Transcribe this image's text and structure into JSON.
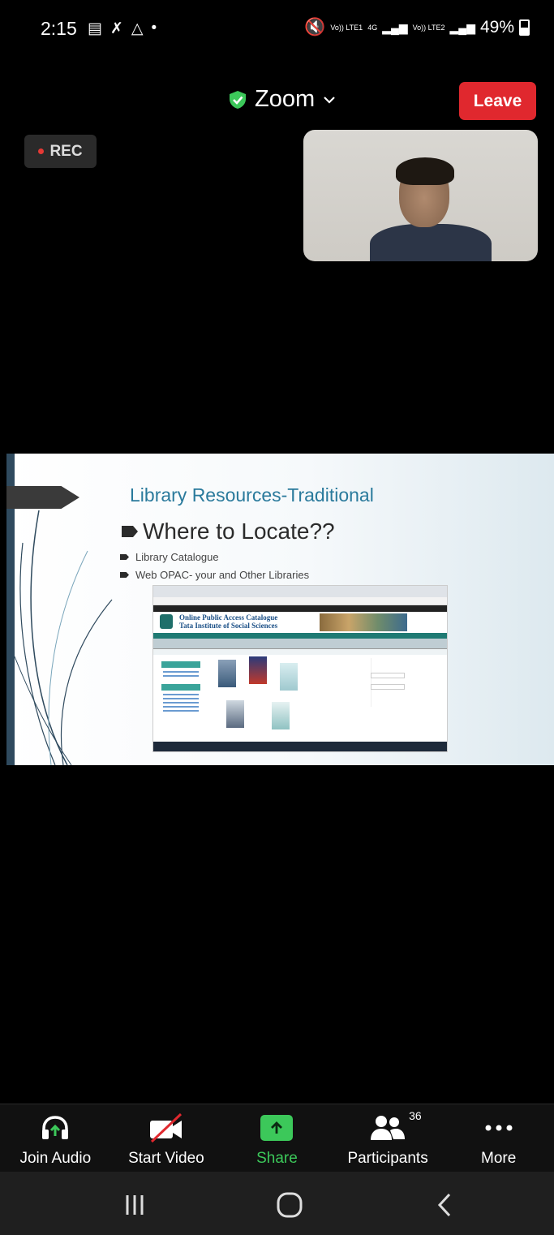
{
  "status_bar": {
    "time": "2:15",
    "network_1": "Vo)) LTE1",
    "network_mid": "4G",
    "network_2": "Vo)) LTE2",
    "battery": "49%"
  },
  "header": {
    "meeting_title": "Zoom",
    "leave_label": "Leave",
    "rec_label": "REC"
  },
  "slide": {
    "title": "Library Resources-Traditional",
    "subtitle": "Where to Locate??",
    "bullets": [
      "Library Catalogue",
      "Web OPAC- your and Other Libraries"
    ],
    "opac_title_1": "Online Public Access Catalogue",
    "opac_title_2": "Tata Institute of Social Sciences"
  },
  "toolbar": {
    "join_audio": "Join Audio",
    "start_video": "Start Video",
    "share": "Share",
    "participants": "Participants",
    "participants_count": "36",
    "more": "More"
  },
  "colors": {
    "leave": "#e0282e",
    "share": "#3cc85a",
    "rec_dot": "#e53935",
    "slide_title": "#2a7a9c"
  }
}
